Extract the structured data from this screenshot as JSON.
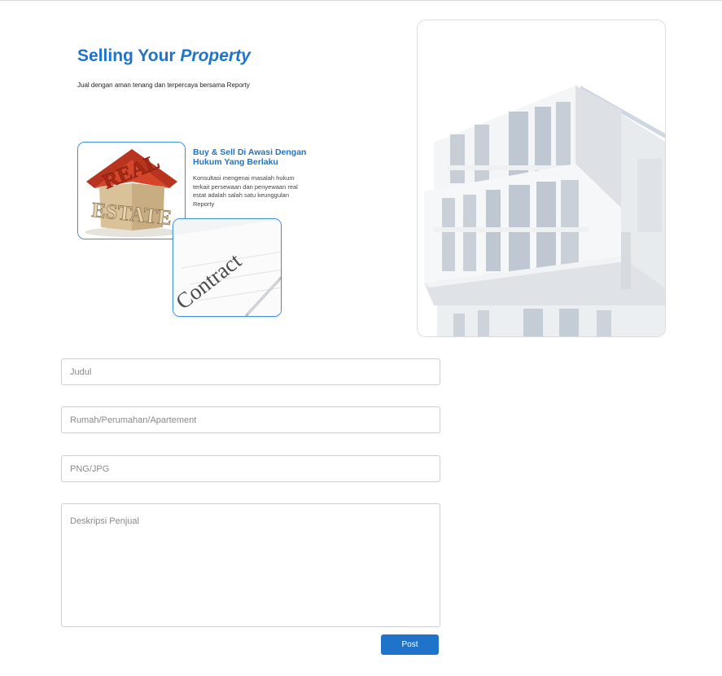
{
  "hero": {
    "title_plain": "Selling Your",
    "title_emphasis": "Property",
    "subtitle": "Jual dengan aman tenang dan terpercaya bersama Reporty"
  },
  "images": {
    "estate": {
      "icon": "real-estate-house-image",
      "word_top": "REAL",
      "word_bottom": "ESTATE"
    },
    "contract": {
      "icon": "contract-document-image",
      "word": "Contract"
    },
    "building": {
      "icon": "building-photo"
    }
  },
  "feature": {
    "title": "Buy & Sell Di Awasi Dengan Hukum Yang Berlaku",
    "description": "Konsultasi mengenai masalah hukum terkait persewaan dan penyewaan real estat adalah salah satu keunggulan Reporty"
  },
  "form": {
    "title_placeholder": "Judul",
    "type_placeholder": "Rumah/Perumahan/Apartement",
    "file_placeholder": "PNG/JPG",
    "description_placeholder": "Deskripsi Penjual",
    "submit_label": "Post"
  },
  "colors": {
    "accent": "#1f74c9",
    "border": "#cfcfcf",
    "placeholder": "#8a8a8a"
  }
}
